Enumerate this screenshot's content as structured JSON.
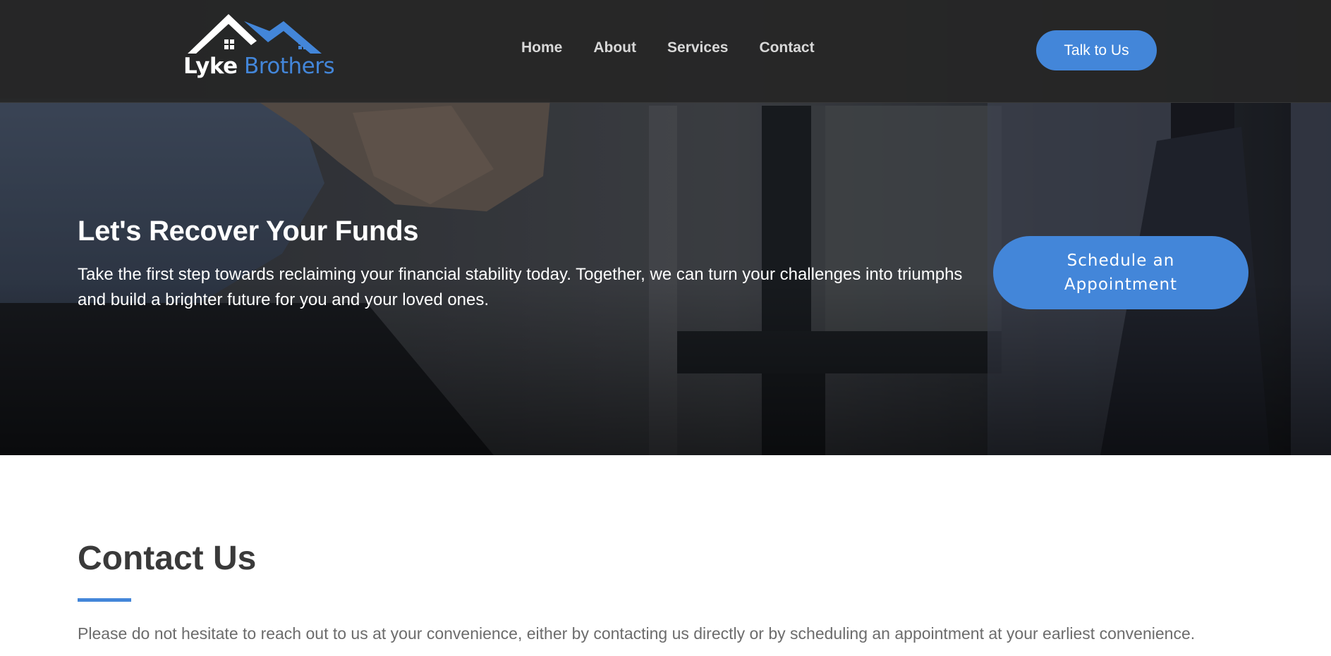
{
  "header": {
    "logo": {
      "word1": "Lyke",
      "word2": "Brothers"
    },
    "nav": {
      "home": "Home",
      "about": "About",
      "services": "Services",
      "contact": "Contact"
    },
    "cta_label": "Talk to Us"
  },
  "hero": {
    "title": "Let's Recover Your Funds",
    "text": "Take the first step towards reclaiming your financial stability today. Together, we can turn your challenges into triumphs and build a brighter future for you and your loved ones.",
    "button_label": "Schedule an Appointment"
  },
  "contact": {
    "title": "Contact Us",
    "text": "Please do not hesitate to reach out to us at your convenience, either by contacting us directly or by scheduling an appointment at your earliest convenience."
  },
  "colors": {
    "accent": "#4386d9",
    "header_bg": "#262626",
    "heading": "#3a3a3a",
    "body_text": "#6c6c6c"
  },
  "icons": {
    "logo": "house-roofs-icon"
  }
}
